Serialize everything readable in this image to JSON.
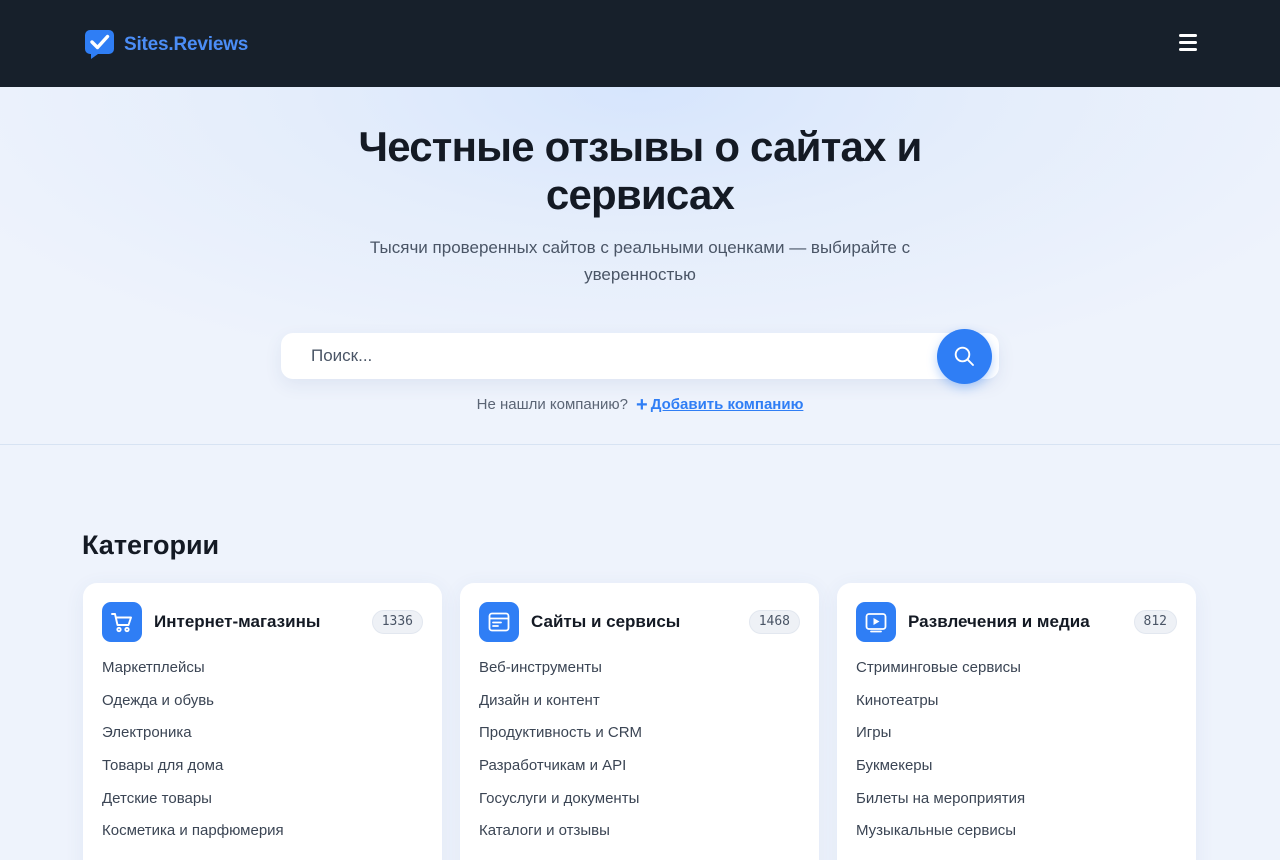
{
  "header": {
    "logo_text_main": "Sites",
    "logo_text_accent": ".Reviews"
  },
  "hero": {
    "title_line1": "Честные отзывы о сайтах и",
    "title_line2": "сервисах",
    "subtitle_line1": "Тысячи проверенных сайтов с реальными оценками — выбирайте с",
    "subtitle_line2": "уверенностью"
  },
  "search": {
    "placeholder": "Поиск..."
  },
  "add_company": {
    "prompt": "Не нашли компанию?",
    "link": "Добавить компанию"
  },
  "categories": {
    "title": "Категории",
    "cards": [
      {
        "icon": "shopping-cart-icon",
        "title": "Интернет-магазины",
        "count": "1336",
        "items": [
          "Маркетплейсы",
          "Одежда и обувь",
          "Электроника",
          "Товары для дома",
          "Детские товары",
          "Косметика и парфюмерия"
        ]
      },
      {
        "icon": "browser-window-icon",
        "title": "Сайты и сервисы",
        "count": "1468",
        "items": [
          "Веб-инструменты",
          "Дизайн и контент",
          "Продуктивность и CRM",
          "Разработчикам и API",
          "Госуслуги и документы",
          "Каталоги и отзывы"
        ]
      },
      {
        "icon": "media-play-icon",
        "title": "Развлечения и медиа",
        "count": "812",
        "items": [
          "Стриминговые сервисы",
          "Кинотеатры",
          "Игры",
          "Букмекеры",
          "Билеты на мероприятия",
          "Музыкальные сервисы"
        ]
      }
    ]
  },
  "colors": {
    "header_bg": "#17202b",
    "accent": "#2f7ef5",
    "logo_text": "#4b8df6",
    "page_bg": "#eef3fc"
  }
}
